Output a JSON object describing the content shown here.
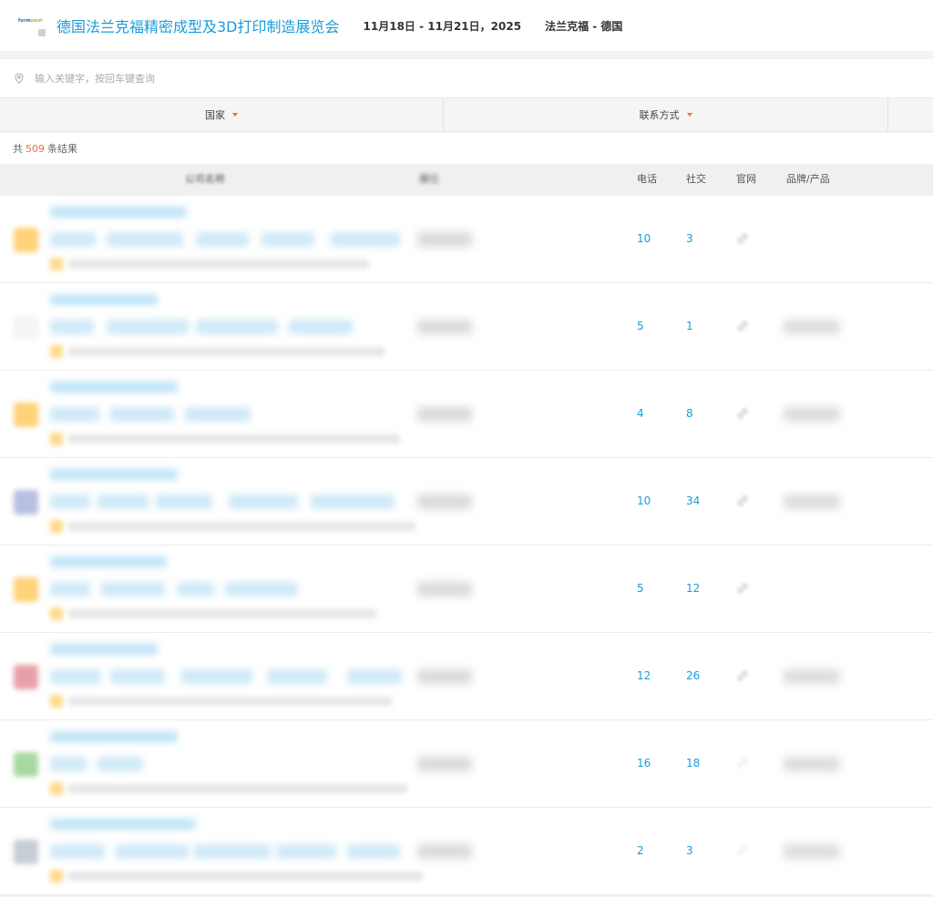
{
  "expo": {
    "title": "德国法兰克福精密成型及3D打印制造展览会",
    "date": "11月18日 - 11月21日，2025",
    "location": "法兰克福 - 德国",
    "logo_text": "form",
    "logo_accent": "next"
  },
  "search": {
    "placeholder": "输入关键字，按回车键查询"
  },
  "filters": {
    "country": "国家",
    "contact": "联系方式"
  },
  "results": {
    "prefix": "共",
    "count": "509",
    "suffix": "条结果"
  },
  "table": {
    "columns": {
      "company": "公司名称",
      "booth": "展位",
      "phone": "电话",
      "social": "社交",
      "web": "官网",
      "brand": "品牌/产品"
    },
    "rows": [
      {
        "phone": "10",
        "social": "3",
        "avatar_color": "#ffd27a",
        "has_web": true,
        "has_brand": false
      },
      {
        "phone": "5",
        "social": "1",
        "avatar_color": "#f5f5f5",
        "has_web": true,
        "has_brand": true
      },
      {
        "phone": "4",
        "social": "8",
        "avatar_color": "#ffd27a",
        "has_web": true,
        "has_brand": true
      },
      {
        "phone": "10",
        "social": "34",
        "avatar_color": "#b8bfe0",
        "has_web": true,
        "has_brand": true
      },
      {
        "phone": "5",
        "social": "12",
        "avatar_color": "#ffd27a",
        "has_web": true,
        "has_brand": false
      },
      {
        "phone": "12",
        "social": "26",
        "avatar_color": "#e8a0a8",
        "has_web": true,
        "has_brand": true
      },
      {
        "phone": "16",
        "social": "18",
        "avatar_color": "#a8d8a0",
        "has_web": false,
        "has_brand": true
      },
      {
        "phone": "2",
        "social": "3",
        "avatar_color": "#c7cdd6",
        "has_web": false,
        "has_brand": true
      }
    ]
  },
  "colors": {
    "accent": "#1a9cd8",
    "highlight": "#f26b3a",
    "background": "#f3f3f3"
  },
  "icons": {
    "search": "location-pin-icon",
    "filter": "caret-down-icon",
    "web": "link-icon"
  }
}
